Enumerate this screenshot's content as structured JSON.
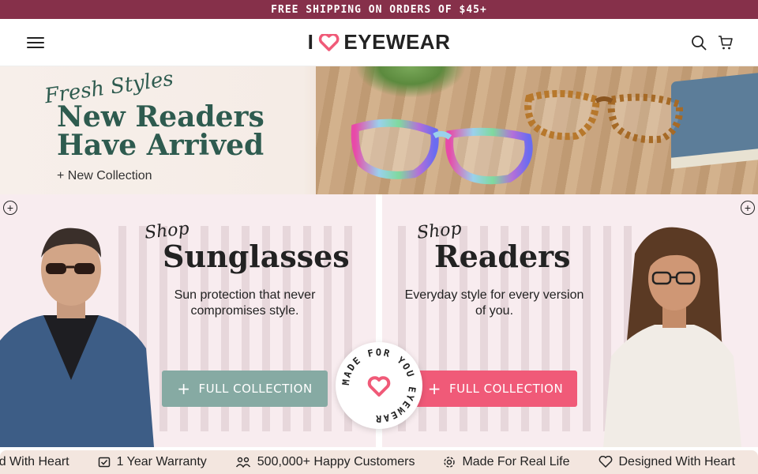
{
  "promo": {
    "text": "FREE SHIPPING ON ORDERS OF $45+"
  },
  "header": {
    "logo_left": "I",
    "logo_right": "EYEWEAR",
    "icons": [
      "menu-icon",
      "search-icon",
      "cart-icon"
    ]
  },
  "hero": {
    "eyebrow": "Fresh Styles",
    "title_line1": "New Readers",
    "title_line2": "Have Arrived",
    "link": "+ New Collection"
  },
  "categories": [
    {
      "eyebrow": "Shop",
      "title": "Sunglasses",
      "desc": "Sun protection that never compromises style.",
      "cta": "FULL COLLECTION",
      "cta_color": "#86aaa3"
    },
    {
      "eyebrow": "Shop",
      "title": "Readers",
      "desc": "Everyday style for every version of you.",
      "cta": "FULL COLLECTION",
      "cta_color": "#f05a78"
    }
  ],
  "badge": {
    "text": "MADE FOR YOU EYEWEAR"
  },
  "strip": {
    "items": [
      {
        "icon": "heart-icon",
        "label": "Designed With Heart"
      },
      {
        "icon": "check-icon",
        "label": "1 Year Warranty"
      },
      {
        "icon": "people-icon",
        "label": "500,000+ Happy Customers"
      },
      {
        "icon": "gear-icon",
        "label": "Made For Real Life"
      },
      {
        "icon": "heart-icon",
        "label": "Designed With Heart"
      }
    ]
  },
  "colors": {
    "brand": "#86304a",
    "accent": "#f05a78",
    "teal": "#86aaa3",
    "heading": "#2e5b4f"
  }
}
